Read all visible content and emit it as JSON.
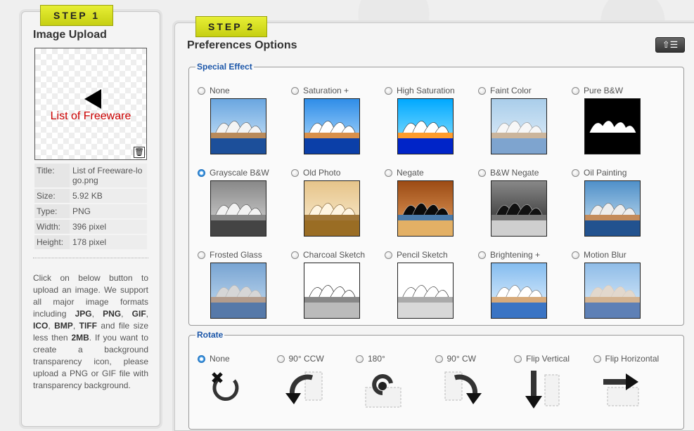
{
  "step1": {
    "badge": "STEP 1",
    "title": "Image Upload",
    "preview_text": "List of Freeware",
    "info": [
      {
        "key": "Title:",
        "value": "List of Freeware-logo.png"
      },
      {
        "key": "Size:",
        "value": "5.92 KB"
      },
      {
        "key": "Type:",
        "value": "PNG"
      },
      {
        "key": "Width:",
        "value": "396 pixel"
      },
      {
        "key": "Height:",
        "value": "178 pixel"
      }
    ],
    "description_html": "Click on below button to upload an image. We support all major image formats including <b>JPG</b>, <b>PNG</b>, <b>GIF</b>, <b>ICO</b>, <b>BMP</b>, <b>TIFF</b> and file size less then <b>2MB</b>. If you want to create a background transparency icon, please upload a PNG or GIF file with transparency background."
  },
  "step2": {
    "badge": "STEP 2",
    "title": "Preferences Options",
    "special_effect": {
      "legend": "Special Effect",
      "selected": "Grayscale B&W",
      "options": [
        "None",
        "Saturation +",
        "High Saturation",
        "Faint Color",
        "Pure B&W",
        "Grayscale B&W",
        "Old Photo",
        "Negate",
        "B&W Negate",
        "Oil Painting",
        "Frosted Glass",
        "Charcoal Sketch",
        "Pencil Sketch",
        "Brightening +",
        "Motion Blur"
      ]
    },
    "rotate": {
      "legend": "Rotate",
      "selected": "None",
      "options": [
        "None",
        "90° CCW",
        "180°",
        "90° CW",
        "Flip Vertical",
        "Flip Horizontal"
      ]
    }
  },
  "colors": {
    "step_badge": "#d6de22",
    "legend": "#1a55a8",
    "radio_selected": "#1d6fbd"
  },
  "icons": {
    "toolbar": "upload-list-icon",
    "delete": "trash-icon"
  }
}
